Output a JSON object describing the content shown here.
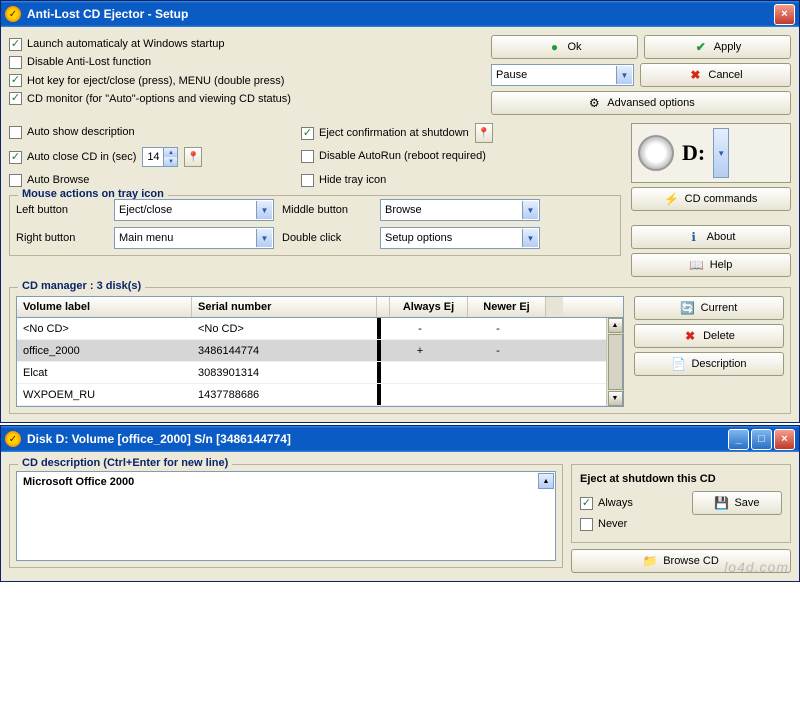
{
  "win1": {
    "title": "Anti-Lost CD Ejector - Setup",
    "top_checks": {
      "launch": {
        "label": "Launch automaticaly at Windows startup",
        "checked": true
      },
      "disable": {
        "label": "Disable Anti-Lost function",
        "checked": false
      },
      "hotkey": {
        "label": "Hot key for eject/close (press), MENU (double press)",
        "checked": true
      },
      "monitor": {
        "label": "CD monitor (for \"Auto\"-options and viewing CD status)",
        "checked": true
      }
    },
    "top_buttons": {
      "ok": "Ok",
      "apply": "Apply",
      "cancel": "Cancel",
      "advanced": "Advansed options",
      "pause_value": "Pause"
    },
    "mid_checks": {
      "autoshow": {
        "label": "Auto show description",
        "checked": false
      },
      "autoclose": {
        "label": "Auto close CD in (sec)",
        "checked": true,
        "value": "14"
      },
      "autobrowse": {
        "label": "Auto Browse",
        "checked": false
      },
      "eject_confirm": {
        "label": "Eject confirmation at shutdown",
        "checked": true
      },
      "disable_autorun": {
        "label": "Disable AutoRun (reboot required)",
        "checked": false
      },
      "hide_tray": {
        "label": "Hide tray icon",
        "checked": false
      }
    },
    "drive": {
      "letter": "D:",
      "cd_commands": "CD commands"
    },
    "mouse": {
      "title": "Mouse actions on tray icon",
      "left_label": "Left button",
      "left_value": "Eject/close",
      "right_label": "Right button",
      "right_value": "Main menu",
      "middle_label": "Middle button",
      "middle_value": "Browse",
      "double_label": "Double click",
      "double_value": "Setup options"
    },
    "buttons2": {
      "about": "About",
      "help": "Help"
    },
    "cdmgr": {
      "title": "CD manager : 3 disk(s)",
      "cols": {
        "c1": "Volume label",
        "c2": "Serial number",
        "c3": "Always Ej",
        "c4": "Newer Ej"
      },
      "rows": [
        {
          "vol": "<No CD>",
          "sn": "<No CD>",
          "ae": "-",
          "ne": "-"
        },
        {
          "vol": "office_2000",
          "sn": "3486144774",
          "ae": "+",
          "ne": "-",
          "sel": true
        },
        {
          "vol": "Elcat",
          "sn": "3083901314",
          "ae": "",
          "ne": ""
        },
        {
          "vol": "WXPOEM_RU",
          "sn": "1437788686",
          "ae": "",
          "ne": ""
        }
      ],
      "btns": {
        "current": "Current",
        "delete": "Delete",
        "desc": "Description"
      }
    }
  },
  "win2": {
    "title": "Disk D:   Volume [office_2000]  S/n [3486144774]",
    "desc_title": "CD description (Ctrl+Enter for new line)",
    "desc_text": "Microsoft Office 2000",
    "eject_group": "Eject at shutdown this CD",
    "always": {
      "label": "Always",
      "checked": true
    },
    "never": {
      "label": "Never",
      "checked": false
    },
    "save": "Save",
    "browse": "Browse CD"
  },
  "watermark": "lo4d.com"
}
